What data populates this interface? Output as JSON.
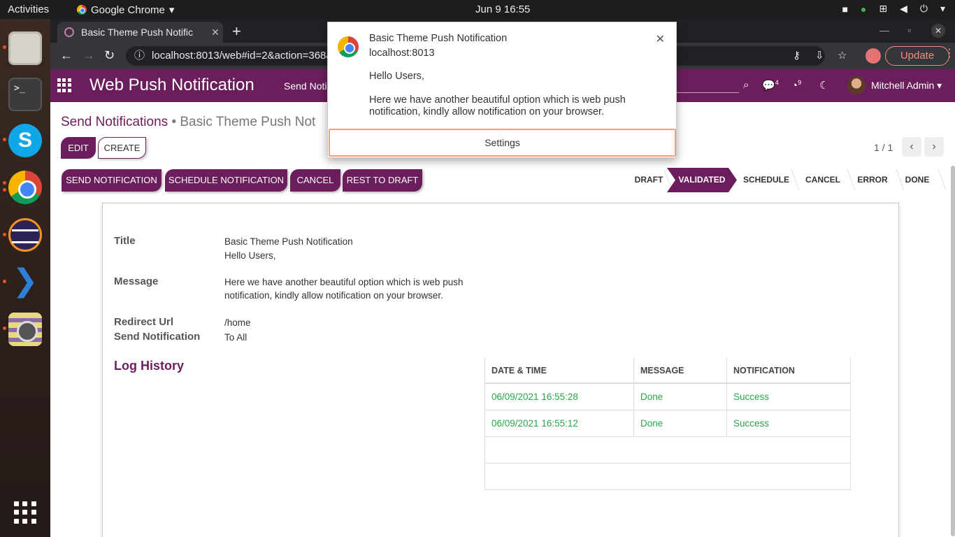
{
  "topbar": {
    "activities": "Activities",
    "app_name": "Google Chrome",
    "clock": "Jun 9  16:55"
  },
  "browser": {
    "tab_title": "Basic Theme Push Notific",
    "url": "localhost:8013/web#id=2&action=368&",
    "update_label": "Update"
  },
  "odoo": {
    "brand": "Web Push Notification",
    "menu_item": "Send Noti",
    "chat_count": "4",
    "activity_count": "9",
    "user_name": "Mitchell Admin"
  },
  "breadcrumb": {
    "parent": "Send Notifications",
    "separator": "•",
    "current": "Basic Theme Push Not"
  },
  "buttons": {
    "edit": "EDIT",
    "create": "CREATE",
    "send_notification": "SEND NOTIFICATION",
    "schedule_notification": "SCHEDULE NOTIFICATION",
    "cancel": "CANCEL",
    "reset_to_draft": "REST TO DRAFT"
  },
  "pager": {
    "value": "1 / 1"
  },
  "stages": [
    {
      "label": "DRAFT",
      "active": false
    },
    {
      "label": "VALIDATED",
      "active": true
    },
    {
      "label": "SCHEDULE",
      "active": false
    },
    {
      "label": "CANCEL",
      "active": false
    },
    {
      "label": "ERROR",
      "active": false
    },
    {
      "label": "DONE",
      "active": false
    }
  ],
  "form": {
    "title_label": "Title",
    "title_value": "Basic Theme Push Notification",
    "message_label": "Message",
    "message_line1": "Hello Users,",
    "message_line2": "Here we have another beautiful option which is web push notification, kindly allow notification on your browser.",
    "redirect_label": "Redirect Url",
    "redirect_value": "/home",
    "send_label": "Send Notification",
    "send_value": "To All"
  },
  "log_history": {
    "title": "Log History",
    "columns": [
      "DATE & TIME",
      "MESSAGE",
      "NOTIFICATION"
    ],
    "rows": [
      [
        "06/09/2021 16:55:28",
        "Done",
        "Success"
      ],
      [
        "06/09/2021 16:55:12",
        "Done",
        "Success"
      ]
    ]
  },
  "notification": {
    "title": "Basic Theme Push Notification",
    "origin": "localhost:8013",
    "body": "Hello Users,\n\nHere we have another beautiful option which is web push notification, kindly allow notification on your browser.",
    "settings_label": "Settings"
  },
  "colors": {
    "brand": "#6c1e5c",
    "success": "#28a745"
  }
}
